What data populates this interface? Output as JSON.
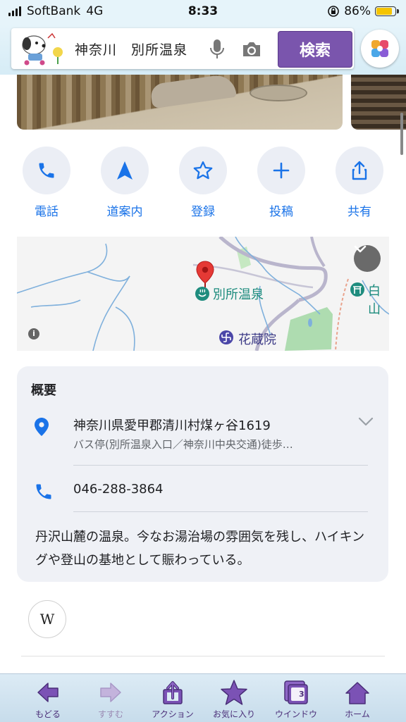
{
  "status_bar": {
    "carrier": "SoftBank",
    "network": "4G",
    "time": "8:33",
    "battery": "86%",
    "battery_level": 0.86
  },
  "search": {
    "query": "神奈川　別所温泉",
    "button_label": "検索"
  },
  "actions": [
    {
      "label": "電話",
      "icon": "phone-icon"
    },
    {
      "label": "道案内",
      "icon": "navigation-arrow-icon"
    },
    {
      "label": "登録",
      "icon": "star-icon"
    },
    {
      "label": "投稿",
      "icon": "plus-icon"
    },
    {
      "label": "共有",
      "icon": "share-icon"
    }
  ],
  "map": {
    "place_label": "別所温泉",
    "temple_label": "花蔵院",
    "edge_label": "白山",
    "colors": {
      "water": "#7fb0dc",
      "road": "#b9b5cc",
      "park": "#aedcb0",
      "pin": "#e53935",
      "onsen": "#1e8c7e"
    }
  },
  "overview": {
    "title": "概要",
    "address": "神奈川県愛甲郡清川村煤ヶ谷1619",
    "address_sub": "バス停(別所温泉入口／神奈川中央交通)徒歩…",
    "phone": "046-288-3864",
    "description": "丹沢山麓の温泉。今なお湯治場の雰囲気を残し、ハイキングや登山の基地として賑わっている。"
  },
  "wiki_label": "W",
  "toolbar": [
    {
      "label": "もどる",
      "icon": "back-arrow-icon",
      "enabled": true
    },
    {
      "label": "すすむ",
      "icon": "forward-arrow-icon",
      "enabled": false
    },
    {
      "label": "アクション",
      "icon": "share-action-icon",
      "enabled": true
    },
    {
      "label": "お気に入り",
      "icon": "star-favorites-icon",
      "enabled": true
    },
    {
      "label": "ウインドウ",
      "icon": "window-icon",
      "enabled": true,
      "count": "3"
    },
    {
      "label": "ホーム",
      "icon": "home-icon",
      "enabled": true
    }
  ],
  "accent_color": "#1a73e8",
  "search_button_color": "#7a55ad"
}
